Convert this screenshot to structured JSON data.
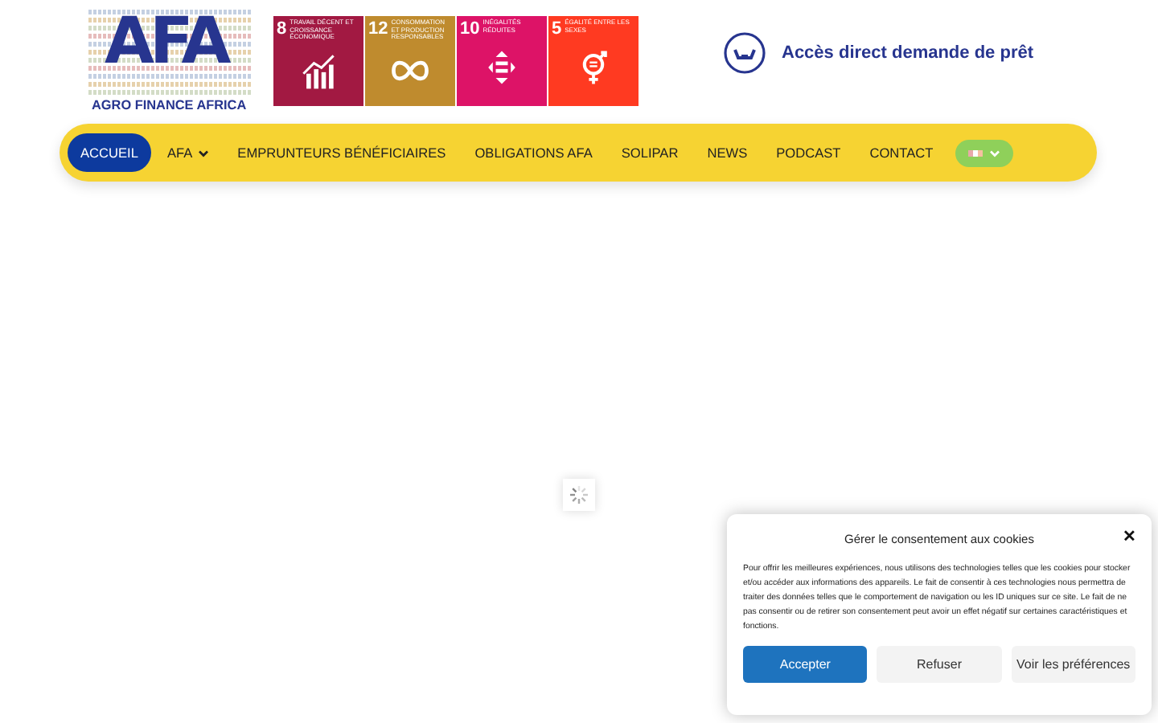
{
  "logo": {
    "initials": "AFA",
    "name": "AGRO FINANCE AFRICA"
  },
  "goals": [
    {
      "number": "8",
      "title": "TRAVAIL DÉCENT ET CROISSANCE ÉCONOMIQUE",
      "color": "#a21942",
      "kind": "growth"
    },
    {
      "number": "12",
      "title": "CONSOMMATION ET PRODUCTION RESPONSABLES",
      "color": "#bf8b2e",
      "kind": "infinity"
    },
    {
      "number": "10",
      "title": "INÉGALITÉS RÉDUITES",
      "color": "#dd1367",
      "kind": "equality"
    },
    {
      "number": "5",
      "title": "ÉGALITÉ ENTRE LES SEXES",
      "color": "#ff3a21",
      "kind": "gender"
    }
  ],
  "loan_link": "Accès direct demande de prêt",
  "nav": [
    {
      "label": "ACCUEIL",
      "selected": true,
      "dropdown": false
    },
    {
      "label": "AFA",
      "selected": false,
      "dropdown": true
    },
    {
      "label": "EMPRUNTEURS BÉNÉFICIAIRES",
      "selected": false,
      "dropdown": false
    },
    {
      "label": "OBLIGATIONS AFA",
      "selected": false,
      "dropdown": false
    },
    {
      "label": "SOLIPAR",
      "selected": false,
      "dropdown": false
    },
    {
      "label": "NEWS",
      "selected": false,
      "dropdown": false
    },
    {
      "label": "PODCAST",
      "selected": false,
      "dropdown": false
    },
    {
      "label": "CONTACT",
      "selected": false,
      "dropdown": false
    }
  ],
  "cookie": {
    "title": "Gérer le consentement aux cookies",
    "close": "✕",
    "text": "Pour offrir les meilleures expériences, nous utilisons des technologies telles que les cookies pour stocker et/ou accéder aux informations des appareils. Le fait de consentir à ces technologies nous permettra de traiter des données telles que le comportement de navigation ou les ID uniques sur ce site. Le fait de ne pas consentir ou de retirer son consentement peut avoir un effet négatif sur certaines caractéristiques et fonctions.",
    "buttons": [
      {
        "label": "Accepter",
        "kind": "primary"
      },
      {
        "label": "Refuser",
        "kind": "plain"
      },
      {
        "label": "Voir les préférences",
        "kind": "plain"
      }
    ]
  }
}
